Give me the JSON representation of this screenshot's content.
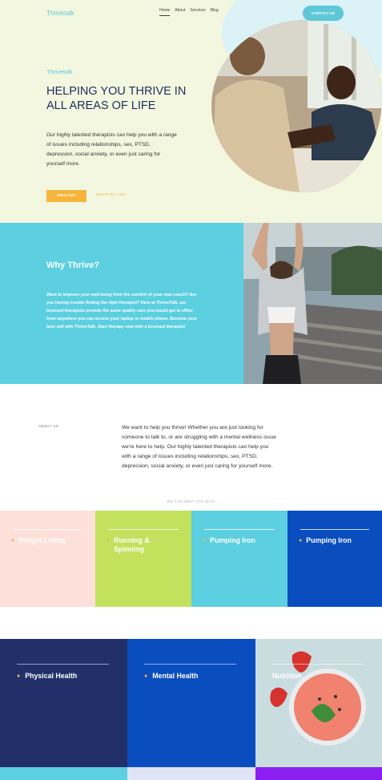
{
  "header": {
    "logo": "Thrivetalk",
    "nav": [
      "Home",
      "About",
      "Services",
      "Blog"
    ],
    "contact_label": "CONTACT US"
  },
  "hero": {
    "kicker": "Thrivetalk",
    "title": "HELPING YOU THRIVE IN ALL AREAS OF LIFE",
    "body": "Our highly talented therapists can help you with a range of issues including relationships, sex, PTSD, depression, social anxiety, or even just caring for yourself more.",
    "primary_button": "WHO AM I",
    "secondary_button": "WHAT DO I DO"
  },
  "why": {
    "title": "Why Thrive?",
    "body": "Want to improve your well-being from the comfort of your own couch? Are you having trouble finding the right therapist? Here at ThriveTalk, our licensed therapists provide the same quality care you would get in office from anywhere you can access your laptop or mobile phone. Become your best self with ThriveTalk. Start therapy now with a licensed therapist!"
  },
  "about": {
    "label": "ABOUT US",
    "body": "We want to help you thrive! Whether you are just looking for someone to talk to, or are struggling with a mental wellness issue we're here to help. Our highly talented therapists can help you with a range of issues including relationships, sex, PTSD, depression, social anxiety, or even just caring for yourself more."
  },
  "help_label": "WE CAN HELP YOU WITH",
  "services_row1": [
    {
      "label": "Weight Lifting",
      "color": "#fde0da"
    },
    {
      "label": "Running & Spinning",
      "color": "#c2e25e"
    },
    {
      "label": "Pumping Iron",
      "color": "#5ccfe0"
    },
    {
      "label": "Pumping Iron",
      "color": "#0a4dbf"
    }
  ],
  "services_row2": [
    {
      "label": "Physical Health",
      "color": "#22306a"
    },
    {
      "label": "Mental Health",
      "color": "#0a4dbf"
    },
    {
      "label": "Nutrition",
      "color": "#c9dde0"
    }
  ],
  "colors": {
    "accent": "#5ec7d8",
    "orange": "#f6b53a",
    "navy": "#1e2d5c",
    "hero_bg": "#f3f7e0"
  }
}
